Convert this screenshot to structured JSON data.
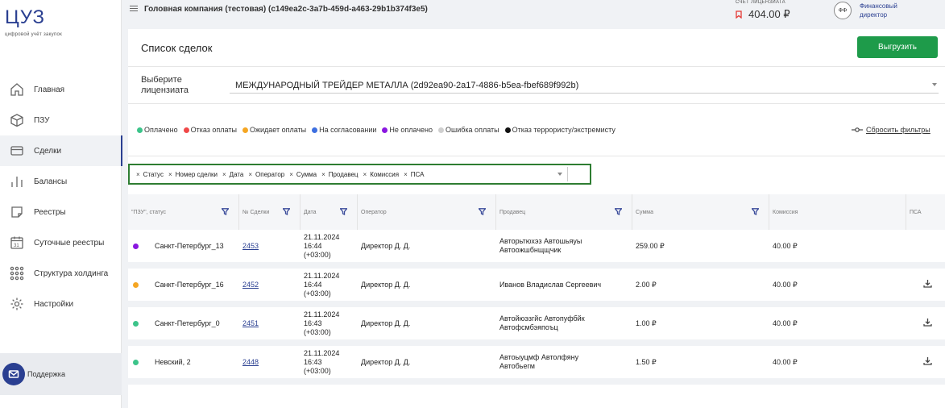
{
  "app": {
    "logo": "ЦУЗ",
    "logo_sub": "цифровой учёт закупок"
  },
  "sidebar": {
    "items": [
      {
        "label": "Главная",
        "icon": "home-icon"
      },
      {
        "label": "ПЗУ",
        "icon": "box-icon"
      },
      {
        "label": "Сделки",
        "icon": "card-icon",
        "active": true
      },
      {
        "label": "Балансы",
        "icon": "bars-icon"
      },
      {
        "label": "Реестры",
        "icon": "note-icon"
      },
      {
        "label": "Суточные реестры",
        "icon": "calendar-icon"
      },
      {
        "label": "Структура холдинга",
        "icon": "network-icon"
      },
      {
        "label": "Настройки",
        "icon": "gear-icon"
      }
    ],
    "support": "Поддержка",
    "calendar_day": "31"
  },
  "topbar": {
    "company": "Головная компания (тестовая) (c149ea2c-3a7b-459d-a463-29b1b374f3e5)",
    "license_label": "СЧЕТ ЛИЦЕНЗИАТА",
    "license_amount": "404.00 ₽",
    "avatar_initials": "ФФ",
    "role": "Финансовый директор"
  },
  "main": {
    "title": "Список сделок",
    "export_button": "Выгрузить",
    "licensee_label": "Выберите лицензиата",
    "licensee_value": "МЕЖДУНАРОДНЫЙ ТРЕЙДЕР МЕТАЛЛА (2d92ea90-2a17-4886-b5ea-fbef689f992b)",
    "legend": [
      {
        "label": "Оплачено",
        "color": "#3cc48a"
      },
      {
        "label": "Отказ оплаты",
        "color": "#f04848"
      },
      {
        "label": "Ожидает оплаты",
        "color": "#f5a623"
      },
      {
        "label": "На согласовании",
        "color": "#3d6fe0"
      },
      {
        "label": "Не оплачено",
        "color": "#8a17e0"
      },
      {
        "label": "Ошибка оплаты",
        "color": "#cfcfcf"
      },
      {
        "label": "Отказ террористу/экстремисту",
        "color": "#111111"
      }
    ],
    "reset_filters": "Сбросить фильтры",
    "column_chips": [
      "Статус",
      "Номер сделки",
      "Дата",
      "Оператор",
      "Сумма",
      "Продавец",
      "Комиссия",
      "ПСА"
    ]
  },
  "table": {
    "headers": [
      "\"ПЗУ\", статус",
      "№ Сделки",
      "Дата",
      "Оператор",
      "Продавец",
      "Сумма",
      "Комиссия",
      "ПСА"
    ],
    "rows": [
      {
        "status_color": "#8a17e0",
        "pzu": "Санкт-Петербург_13",
        "deal": "2453",
        "date": "21.11.2024",
        "time": "16:44",
        "tz": "(+03:00)",
        "operator": "Директор Д. Д.",
        "seller": "Авторьтюхэз Автошьяуы Автоожшбнщщчик",
        "sum": "259.00 ₽",
        "commission": "40.00 ₽",
        "psa": false
      },
      {
        "status_color": "#f5a623",
        "pzu": "Санкт-Петербург_16",
        "deal": "2452",
        "date": "21.11.2024",
        "time": "16:44",
        "tz": "(+03:00)",
        "operator": "Директор Д. Д.",
        "seller": "Иванов Владислав Сергеевич",
        "sum": "2.00 ₽",
        "commission": "40.00 ₽",
        "psa": true
      },
      {
        "status_color": "#3cc48a",
        "pzu": "Санкт-Петербург_0",
        "deal": "2451",
        "date": "21.11.2024",
        "time": "16:43",
        "tz": "(+03:00)",
        "operator": "Директор Д. Д.",
        "seller": "Автойюэзгйс Автопуфбйк Автофсмбэяпоъц",
        "sum": "1.00 ₽",
        "commission": "40.00 ₽",
        "psa": true
      },
      {
        "status_color": "#3cc48a",
        "pzu": "Невский, 2",
        "deal": "2448",
        "date": "21.11.2024",
        "time": "16:43",
        "tz": "(+03:00)",
        "operator": "Директор Д. Д.",
        "seller": "Автоыуцмф Автолфяну Автобьегм",
        "sum": "1.50 ₽",
        "commission": "40.00 ₽",
        "psa": true
      }
    ]
  }
}
